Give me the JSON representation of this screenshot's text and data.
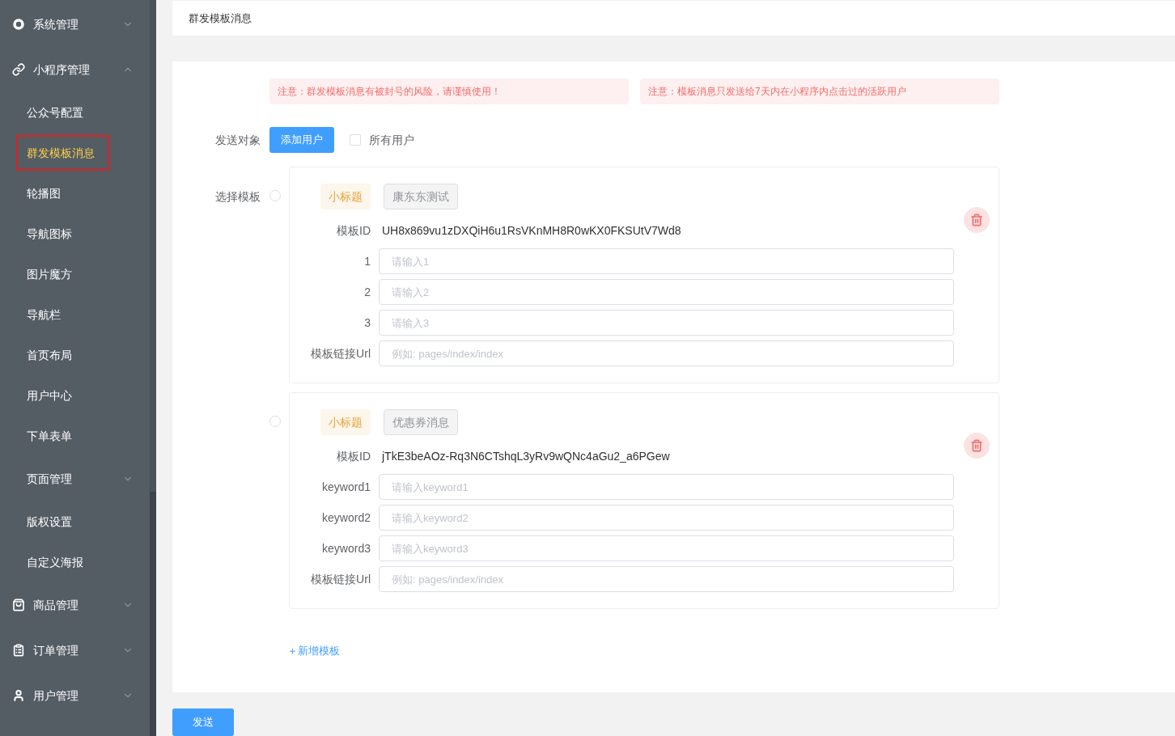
{
  "sidebar": {
    "items": [
      {
        "kind": "group",
        "label": "系统管理",
        "expanded": false
      },
      {
        "kind": "group",
        "label": "小程序管理",
        "expanded": true
      },
      {
        "kind": "item",
        "label": "公众号配置",
        "selected": false
      },
      {
        "kind": "item",
        "label": "群发模板消息",
        "selected": true
      },
      {
        "kind": "item",
        "label": "轮播图",
        "selected": false
      },
      {
        "kind": "item",
        "label": "导航图标",
        "selected": false
      },
      {
        "kind": "item",
        "label": "图片魔方",
        "selected": false
      },
      {
        "kind": "item",
        "label": "导航栏",
        "selected": false
      },
      {
        "kind": "item",
        "label": "首页布局",
        "selected": false
      },
      {
        "kind": "item",
        "label": "用户中心",
        "selected": false
      },
      {
        "kind": "item",
        "label": "下单表单",
        "selected": false
      },
      {
        "kind": "submenu",
        "label": "页面管理",
        "expanded": false
      },
      {
        "kind": "item",
        "label": "版权设置",
        "selected": false
      },
      {
        "kind": "item",
        "label": "自定义海报",
        "selected": false
      },
      {
        "kind": "group",
        "label": "商品管理",
        "expanded": false
      },
      {
        "kind": "group",
        "label": "订单管理",
        "expanded": false
      },
      {
        "kind": "group",
        "label": "用户管理",
        "expanded": false
      }
    ]
  },
  "page_title": "群发模板消息",
  "alerts": [
    "注意：群发模板消息有被封号的风险，请谨慎使用！",
    "注意：模板消息只发送给7天内在小程序内点击过的活跃用户"
  ],
  "send_target": {
    "label": "发送对象",
    "button": "添加用户",
    "all_users": {
      "label": "所有用户",
      "checked": false
    }
  },
  "template_label": "选择模板",
  "templates": [
    {
      "selected": false,
      "subtitle_tag": "小标题",
      "name": "康东东测试",
      "id_label": "模板ID",
      "id": "UH8x869vu1zDXQiH6u1RsVKnMH8R0wKX0FKSUtV7Wd8",
      "fields": [
        {
          "label": "1",
          "placeholder": "请输入1"
        },
        {
          "label": "2",
          "placeholder": "请输入2"
        },
        {
          "label": "3",
          "placeholder": "请输入3"
        },
        {
          "label": "模板链接Url",
          "placeholder": "例如: pages/index/index"
        }
      ]
    },
    {
      "selected": false,
      "subtitle_tag": "小标题",
      "name": "优惠券消息",
      "id_label": "模板ID",
      "id": "jTkE3beAOz-Rq3N6CTshqL3yRv9wQNc4aGu2_a6PGew",
      "fields": [
        {
          "label": "keyword1",
          "placeholder": "请输入keyword1"
        },
        {
          "label": "keyword2",
          "placeholder": "请输入keyword2"
        },
        {
          "label": "keyword3",
          "placeholder": "请输入keyword3"
        },
        {
          "label": "模板链接Url",
          "placeholder": "例如: pages/index/index"
        }
      ]
    }
  ],
  "add_template": "＋新增模板",
  "send_button": "发送"
}
